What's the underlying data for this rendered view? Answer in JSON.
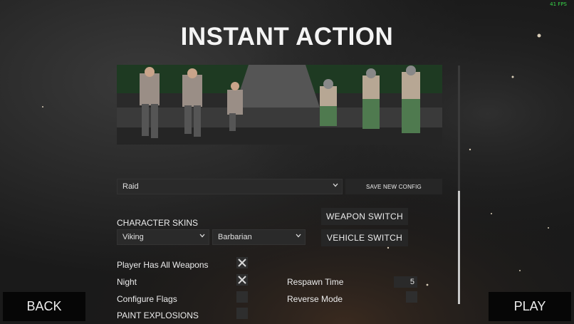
{
  "hud": {
    "fps": "41 FPS"
  },
  "title": "INSTANT ACTION",
  "preview": {
    "scene": "soldier character skins preview"
  },
  "config": {
    "selected": "Raid",
    "save_label": "SAVE NEW CONFIG"
  },
  "skins": {
    "heading": "CHARACTER SKINS",
    "team1": "Viking",
    "team2": "Barbarian"
  },
  "switches": {
    "weapon": "WEAPON SWITCH",
    "vehicle": "VEHICLE SWITCH"
  },
  "options": {
    "all_weapons": {
      "label": "Player Has All Weapons",
      "checked": true
    },
    "night": {
      "label": "Night",
      "checked": true
    },
    "configure_flags": {
      "label": "Configure Flags",
      "checked": false
    },
    "paint_explosions": {
      "label": "PAINT EXPLOSIONS",
      "checked": false
    },
    "respawn_time": {
      "label": "Respawn Time",
      "value": "5"
    },
    "reverse_mode": {
      "label": "Reverse Mode",
      "checked": false
    }
  },
  "nav": {
    "back": "BACK",
    "play": "PLAY"
  },
  "colors": {
    "fps": "#39d84a",
    "background": "#1b1b1b",
    "button": "#060606"
  }
}
